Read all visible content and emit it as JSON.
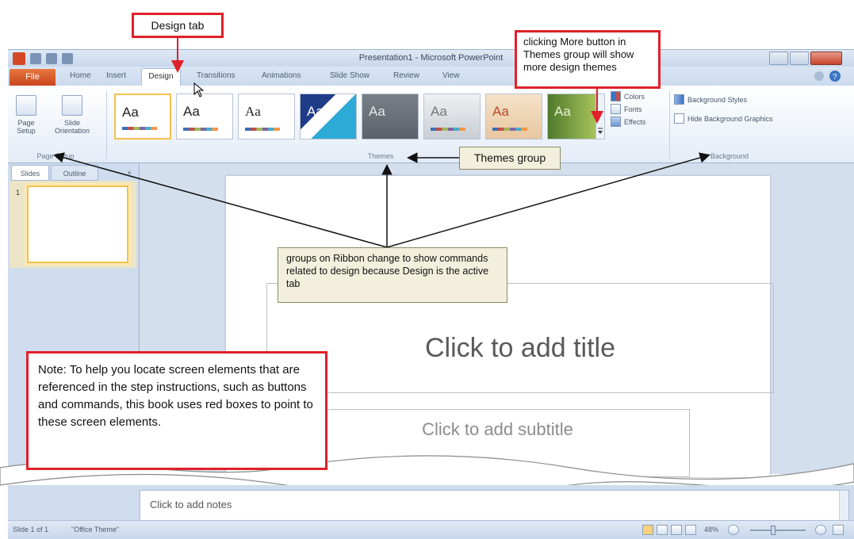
{
  "window": {
    "title": "Presentation1 - Microsoft PowerPoint"
  },
  "ribbon": {
    "tabs": [
      "File",
      "Home",
      "Insert",
      "Design",
      "Transitions",
      "Animations",
      "Slide Show",
      "Review",
      "View"
    ],
    "page_setup": {
      "page_setup": "Page Setup",
      "slide_orientation": "Slide Orientation",
      "group_label": "Page Setup"
    },
    "themes": {
      "sample": "Aa",
      "group_label": "Themes",
      "colors": "Colors",
      "fonts": "Fonts",
      "effects": "Effects"
    },
    "background": {
      "background_styles": "Background Styles",
      "hide_graphics": "Hide Background Graphics",
      "group_label": "Background"
    }
  },
  "left_pane": {
    "tabs": [
      "Slides",
      "Outline"
    ],
    "close": "×",
    "slide_number": "1"
  },
  "slide": {
    "title_placeholder": "Click to add title",
    "subtitle_placeholder": "Click to add subtitle"
  },
  "notes": {
    "placeholder": "Click to add notes"
  },
  "status": {
    "slide_info": "Slide 1 of 1",
    "theme": "\"Office Theme\"",
    "zoom": "48%"
  },
  "callouts": {
    "design_tab": "Design tab",
    "more_button": "clicking More button in Themes group will show more design themes",
    "themes_group": "Themes group",
    "groups_on_ribbon": "groups on Ribbon change to show commands related to design because Design is the active tab",
    "note": "Note: To help you locate screen elements that are referenced in the step instructions, such as buttons and commands, this book uses red boxes to point to these screen elements."
  },
  "colors": {
    "callout_red": "#e0202a",
    "file_tab": "#d24726",
    "callout_tan": "#f2f0dc"
  }
}
